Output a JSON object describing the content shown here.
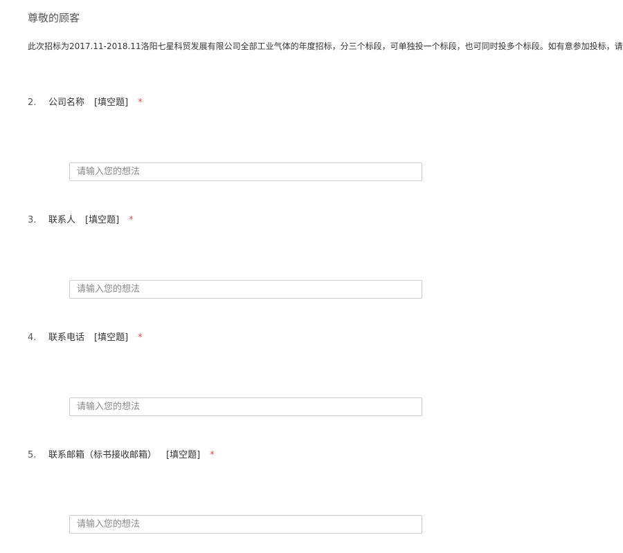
{
  "header": {
    "greeting": "尊敬的顾客",
    "intro": "此次招标为2017.11-2018.11洛阳七星科贸发展有限公司全部工业气体的年度招标，分三个标段，可单独投一个标段，也可同时投多个标段。如有意参加投标，请详"
  },
  "questions": [
    {
      "number": "2.",
      "title": "公司名称",
      "type": "[填空题]",
      "required_mark": "*",
      "placeholder": "请输入您的想法"
    },
    {
      "number": "3.",
      "title": "联系人",
      "type": "[填空题]",
      "required_mark": "*",
      "placeholder": "请输入您的想法"
    },
    {
      "number": "4.",
      "title": "联系电话",
      "type": "[填空题]",
      "required_mark": "*",
      "placeholder": "请输入您的想法"
    },
    {
      "number": "5.",
      "title": "联系邮箱（标书接收邮箱）",
      "type": "[填空题]",
      "required_mark": "*",
      "placeholder": "请输入您的想法"
    }
  ],
  "colors": {
    "required": "#e84c4c",
    "input_border": "#cccccc"
  }
}
